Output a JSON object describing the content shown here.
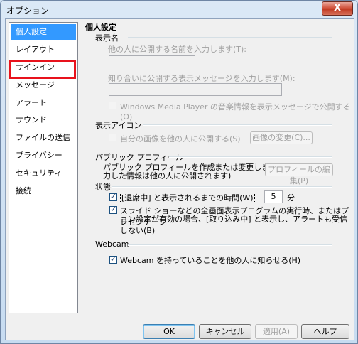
{
  "window": {
    "title": "オプション",
    "close_label": "X"
  },
  "sidebar": {
    "items": [
      {
        "label": "個人設定"
      },
      {
        "label": "レイアウト"
      },
      {
        "label": "サインイン"
      },
      {
        "label": "メッセージ"
      },
      {
        "label": "アラート"
      },
      {
        "label": "サウンド"
      },
      {
        "label": "ファイルの送信"
      },
      {
        "label": "プライバシー"
      },
      {
        "label": "セキュリティ"
      },
      {
        "label": "接続"
      }
    ],
    "selected_index": 0,
    "highlighted_index": 2
  },
  "panel": {
    "heading": "個人設定",
    "display_name": {
      "section": "表示名",
      "name_label": "他の人に公開する名前を入力します(T):",
      "name_value": "",
      "message_label": "知り合いに公開する表示メッセージを入力します(M):",
      "message_value": "",
      "wmp_label": "Windows Media Player の音楽情報を表示メッセージで公開する(O)"
    },
    "display_icon": {
      "section": "表示アイコン",
      "share_label": "自分の画像を他の人に公開する(S)",
      "change_button": "画像の変更(C)..."
    },
    "public_profile": {
      "section": "パブリック プロフィール",
      "description_line1": "パブリック プロフィールを作成または変更します (ここで入",
      "description_line2": "力した情報は他の人に公開されます)",
      "edit_button": "プロフィールの編集(P)"
    },
    "status": {
      "section": "状態",
      "away_label": "[退席中] と表示されるまでの時間(W)",
      "away_minutes": "5",
      "away_unit": "分",
      "fullscreen_line1": "スライド ショーなどの全画面表示プログラムの実行時、またはプレゼンテーシ",
      "fullscreen_line2": "ョン設定が有効の場合、[取り込み中] と表示し、アラートも受信しない(B)"
    },
    "webcam": {
      "section": "Webcam",
      "share_label": "Webcam を持っていることを他の人に知らせる(H)"
    }
  },
  "footer": {
    "ok": "OK",
    "cancel": "キャンセル",
    "apply": "適用(A)",
    "help": "ヘルプ"
  }
}
